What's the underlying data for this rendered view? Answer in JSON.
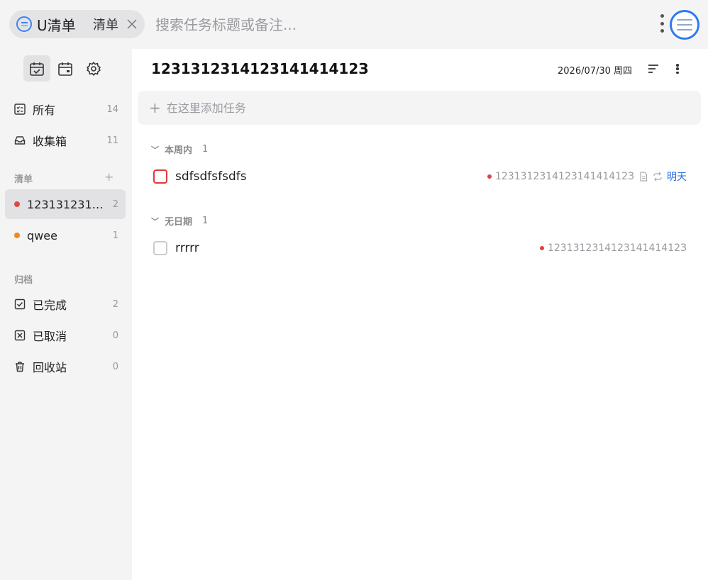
{
  "header": {
    "app_name": "U清单",
    "current_list": "清单",
    "search_placeholder": "搜索任务标题或备注..."
  },
  "sidebar": {
    "view_icons": [
      "calendar-check-icon",
      "calendar-icon",
      "gear-icon"
    ],
    "smart_lists": [
      {
        "label": "所有",
        "count": "14",
        "icon": "checklist-icon"
      },
      {
        "label": "收集箱",
        "count": "11",
        "icon": "inbox-icon"
      }
    ],
    "lists_section": "清单",
    "lists": [
      {
        "label": "1231312314...",
        "count": "2",
        "color": "#e04848",
        "active": true
      },
      {
        "label": "qwee",
        "count": "1",
        "color": "#f08a1c",
        "active": false
      }
    ],
    "archive_section": "归档",
    "archive": [
      {
        "label": "已完成",
        "count": "2",
        "icon": "check-square-icon"
      },
      {
        "label": "已取消",
        "count": "0",
        "icon": "x-square-icon"
      },
      {
        "label": "回收站",
        "count": "0",
        "icon": "trash-icon"
      }
    ]
  },
  "main": {
    "title": "123131231412314141412З",
    "date": "2026/07/30 周四",
    "add_placeholder": "在这里添加任务",
    "groups": [
      {
        "label": "本周内",
        "count": "1",
        "tasks": [
          {
            "title": "sdfsdfsfsdfs",
            "list": "123131231412314141412З",
            "due": "明天",
            "has_note": true,
            "repeat": true
          }
        ]
      },
      {
        "label": "无日期",
        "count": "1",
        "tasks": [
          {
            "title": "rrrrr",
            "list": "123131231412314141412З"
          }
        ]
      }
    ]
  },
  "colors": {
    "accent": "#2f7bf0",
    "priority_red": "#dc3b3b",
    "list_red": "#e04848",
    "list_orange": "#f08a1c"
  }
}
